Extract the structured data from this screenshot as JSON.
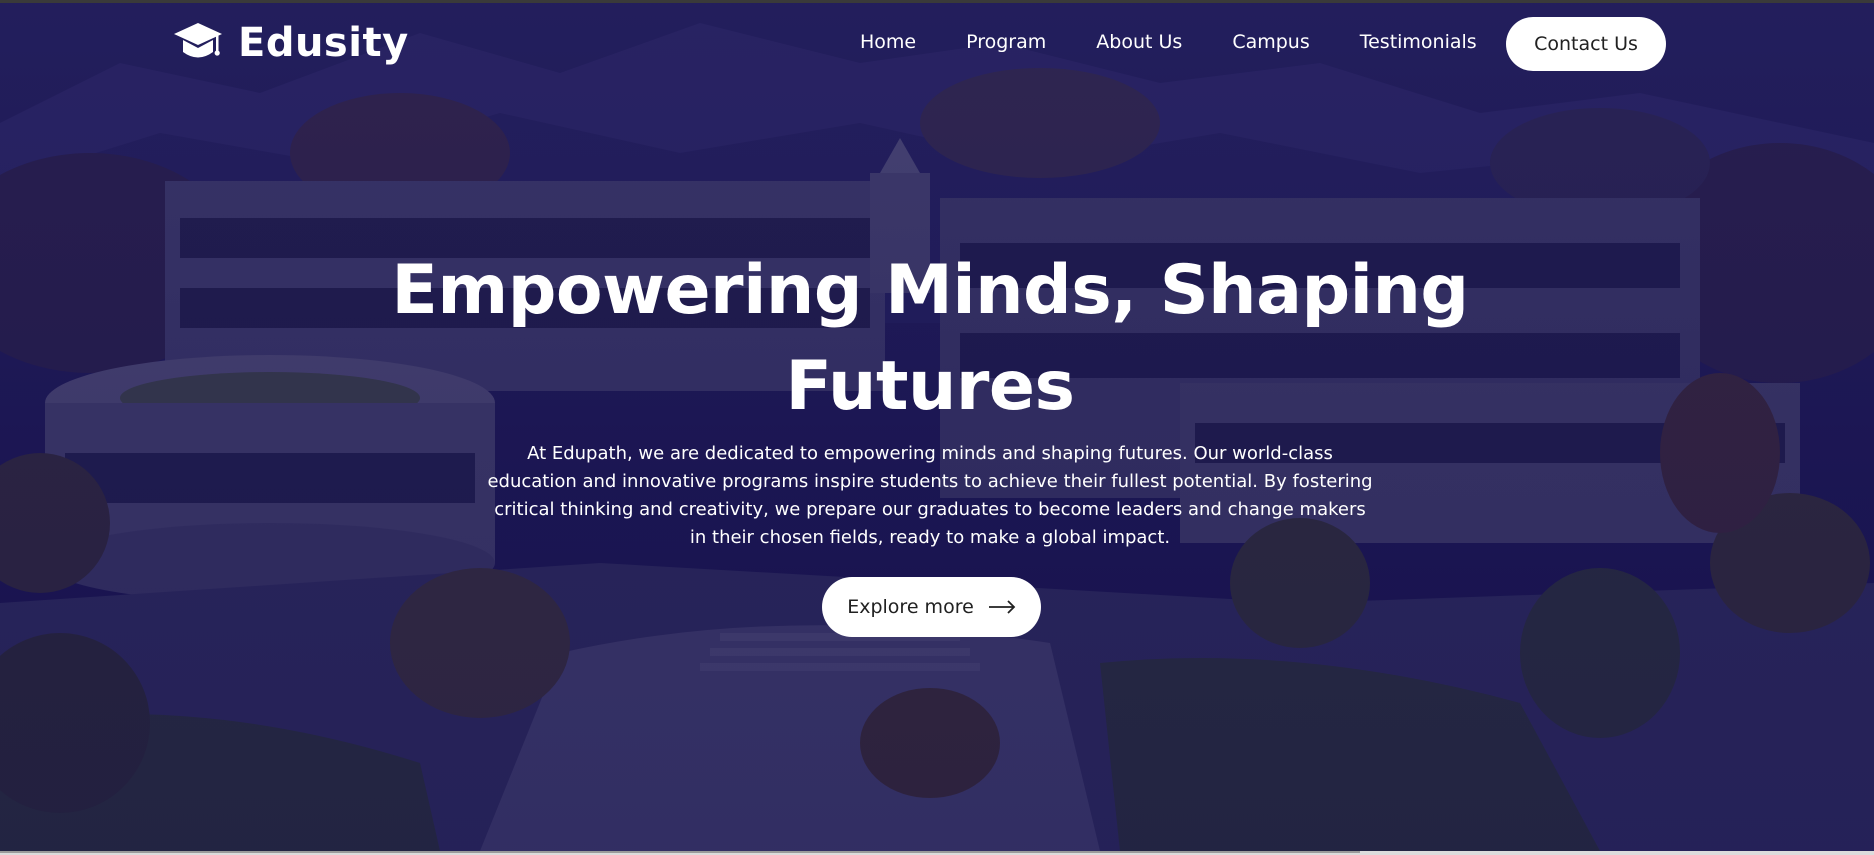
{
  "brand": {
    "name": "Edusity",
    "logo_icon": "graduation-cap-icon"
  },
  "nav": {
    "items": [
      {
        "label": "Home"
      },
      {
        "label": "Program"
      },
      {
        "label": "About Us"
      },
      {
        "label": "Campus"
      },
      {
        "label": "Testimonials"
      }
    ],
    "contact_label": "Contact Us"
  },
  "hero": {
    "headline_line1": "Empowering Minds, Shaping",
    "headline_line2": "Futures",
    "description": "At Edupath, we are dedicated to empowering minds and shaping futures. Our world-class education and innovative programs inspire students to achieve their fullest potential. By fostering critical thinking and creativity, we prepare our graduates to become leaders and change makers in their chosen fields, ready to make a global impact.",
    "cta_label": "Explore more",
    "cta_icon": "arrow-right-icon",
    "overlay_color": "#0c0846"
  },
  "colors": {
    "button_bg": "#ffffff",
    "button_text": "#212121",
    "text_light": "#ffffff"
  }
}
